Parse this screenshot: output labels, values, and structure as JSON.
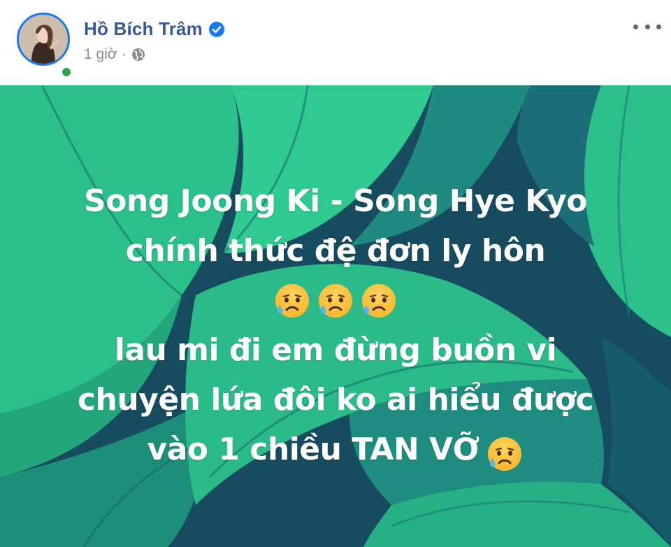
{
  "post": {
    "author": {
      "name": "Hồ Bích Trâm",
      "verified": true,
      "online": true
    },
    "meta": {
      "time": "1 giờ",
      "separator": "·",
      "audience_icon": "globe-icon"
    },
    "menu_icon": "more-options-icon",
    "text_lines": [
      "Song Joong Ki - Song Hye Kyo",
      "chính thức đệ đơn ly hôn",
      "lau mi đi em đừng buồn vi",
      "chuyện lứa đôi ko ai hiểu được",
      "vào 1 chiều TAN VỠ"
    ],
    "emoji": {
      "name": "sad-but-relieved-face-icon",
      "row_count": 3,
      "trailing_count": 1
    },
    "colors": {
      "name": "#385898",
      "verified": "#1877f2",
      "meta": "#8a8d91",
      "background_dark": "#164b60",
      "leaf_green": "#2ec58a",
      "leaf_teal": "#1f8c82",
      "text": "#ffffff"
    }
  }
}
